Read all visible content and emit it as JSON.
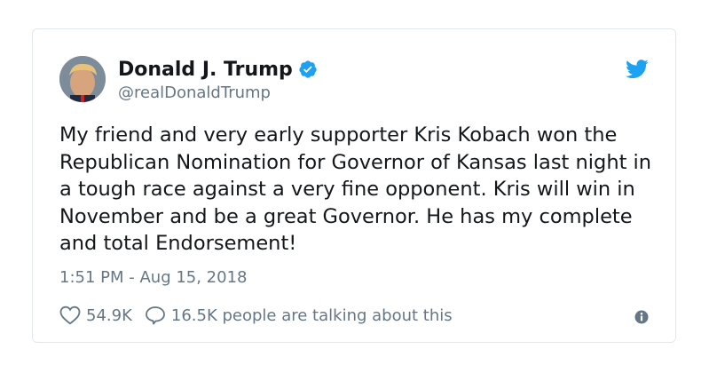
{
  "tweet": {
    "author_name": "Donald J. Trump",
    "handle": "@realDonaldTrump",
    "verified": true,
    "text": "My friend and very early supporter Kris Kobach won the Republican Nomination for Governor of Kansas last night in a tough race against a very fine opponent. Kris will win in November and be a great Governor. He has my complete and total Endorsement!",
    "timestamp": "1:51 PM - Aug 15, 2018",
    "likes": "54.9K",
    "talking": "16.5K people are talking about this"
  },
  "icons": {
    "avatar": "avatar-photo",
    "verified": "verified-badge-icon",
    "brand": "twitter-bird-icon",
    "like": "heart-icon",
    "reply": "speech-bubble-icon",
    "info": "info-icon"
  },
  "colors": {
    "brand": "#1da1f2",
    "text": "#14171a",
    "secondary": "#657786",
    "border": "#e1e8ed"
  }
}
